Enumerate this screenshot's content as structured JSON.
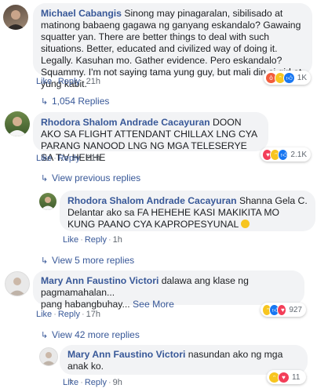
{
  "comments": [
    {
      "author": "Michael Cabangis",
      "text": "Sinong may pinagaralan, sibilisado at matinong babaeng gagawa ng ganyang eskandalo? Gawaing squatter yan. There are better things to deal with such situations. Better, educated and civilized way of doing it. Legally. Kasuhan mo. Gather evidence. Pero eskandalo? Squammy. I'm not saying tama yung guy, but mali din si girl at yung kabit.",
      "like": "Like",
      "reply": "Reply",
      "time": "21h",
      "reaction_count": "1K",
      "view_replies": "1,054 Replies"
    },
    {
      "author": "Rhodora Shalom Andrade Cacayuran",
      "text": "DOON AKO SA FLIGHT ATTENDANT CHILLAX LNG CYA PARANG NANOOD LNG NG MGA TELESERYE SA T.V HEHHE",
      "like": "Like",
      "reply": "Reply",
      "time": "21h",
      "reaction_count": "2.1K",
      "view_previous": "View previous replies"
    },
    {
      "author": "Rhodora Shalom Andrade Cacayuran",
      "text": "Shanna Gela C. Delantar ako sa FA HEHEHE KASI MAKIKITA MO KUNG PAANO CYA KAPROPESYUNAL",
      "like": "Like",
      "reply": "Reply",
      "time": "1h",
      "view_more": "View 5 more replies"
    },
    {
      "author": "Mary Ann Faustino Victori",
      "text": "dalawa ang klase ng pagmamahalan...",
      "text2": "pang habangbuhay...",
      "see_more": "See More",
      "like": "Like",
      "reply": "Reply",
      "time": "17h",
      "reaction_count": "927",
      "view_more": "View 42 more replies"
    },
    {
      "author": "Mary Ann Faustino Victori",
      "text": "nasundan ako ng mga anak ko.",
      "text2": "..",
      "like": "Like",
      "reply": "Reply",
      "time": "9h",
      "reaction_count": "11"
    }
  ],
  "colors": {
    "link": "#385898",
    "bubble": "#f2f3f5",
    "meta": "#606770"
  },
  "icons": {
    "reply_arrow": "reply-arrow-icon",
    "reactions": [
      "angry-icon",
      "haha-icon",
      "like-icon",
      "love-icon"
    ]
  }
}
